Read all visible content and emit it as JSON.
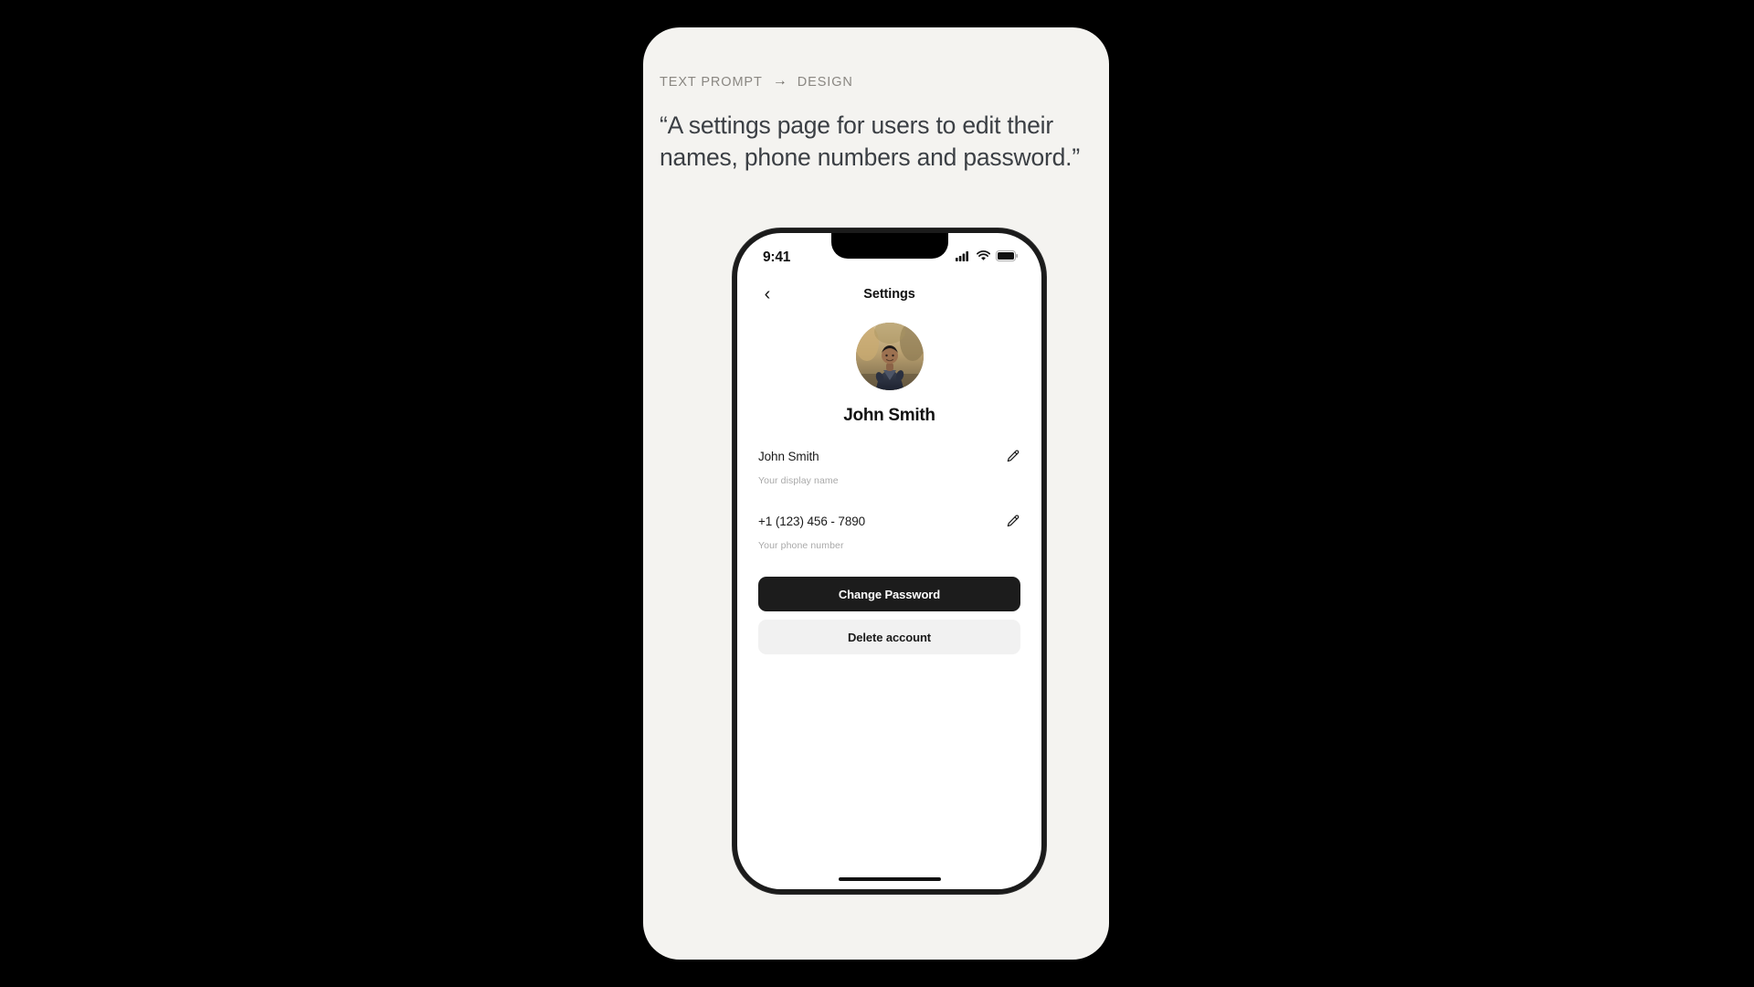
{
  "theme": {
    "page_background": "#000000",
    "card_background": "#f4f3f0",
    "screen_background": "#ffffff",
    "primary_button": "#1c1c1c",
    "secondary_button": "#f1f1f1",
    "text_primary": "#111111",
    "text_muted": "#a9a9a9",
    "breadcrumb_text": "#8a8782",
    "quote_text": "#3b3f44"
  },
  "breadcrumb": {
    "source_label": "TEXT PROMPT",
    "arrow_icon": "arrow-right-icon",
    "target_label": "DESIGN"
  },
  "prompt": {
    "quote": "“A settings page for users to edit their names, phone numbers and password.”"
  },
  "phone": {
    "status_bar": {
      "time": "9:41",
      "icons": [
        "cellular-signal-icon",
        "wifi-icon",
        "battery-icon"
      ]
    },
    "nav_bar": {
      "back_icon": "chevron-left-icon",
      "title": "Settings"
    },
    "profile": {
      "avatar_icon": "user-avatar-photo",
      "avatar_alt": "Photo of a person in a dark jacket with autumn foliage background",
      "name": "John Smith"
    },
    "fields": [
      {
        "value": "John Smith",
        "hint": "Your display name",
        "edit_icon": "pencil-icon"
      },
      {
        "value": "+1 (123) 456 - 7890",
        "hint": "Your phone number",
        "edit_icon": "pencil-icon"
      }
    ],
    "buttons": {
      "primary_label": "Change Password",
      "secondary_label": "Delete account"
    },
    "home_indicator": "home-indicator-bar"
  }
}
